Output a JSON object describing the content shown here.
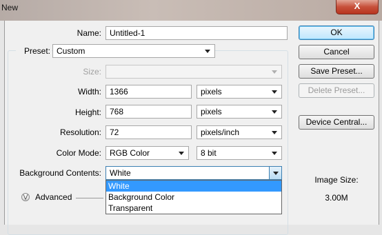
{
  "window": {
    "title": "New",
    "close_glyph": "X"
  },
  "form": {
    "name_label": "Name:",
    "name_value": "Untitled-1",
    "preset_label": "Preset:",
    "preset_value": "Custom",
    "size_label": "Size:",
    "size_value": "",
    "width_label": "Width:",
    "width_value": "1366",
    "width_unit": "pixels",
    "height_label": "Height:",
    "height_value": "768",
    "height_unit": "pixels",
    "resolution_label": "Resolution:",
    "resolution_value": "72",
    "resolution_unit": "pixels/inch",
    "color_mode_label": "Color Mode:",
    "color_mode_value": "RGB Color",
    "bit_depth": "8 bit",
    "background_label": "Background Contents:",
    "background_value": "White"
  },
  "background_options": [
    "White",
    "Background Color",
    "Transparent"
  ],
  "advanced_label": "Advanced",
  "buttons": {
    "ok": "OK",
    "cancel": "Cancel",
    "save_preset": "Save Preset...",
    "delete_preset": "Delete Preset...",
    "device_central": "Device Central..."
  },
  "image_size": {
    "label": "Image Size:",
    "value": "3.00M"
  },
  "colors": {
    "selection": "#3399ff",
    "close_button": "#c7503a"
  }
}
